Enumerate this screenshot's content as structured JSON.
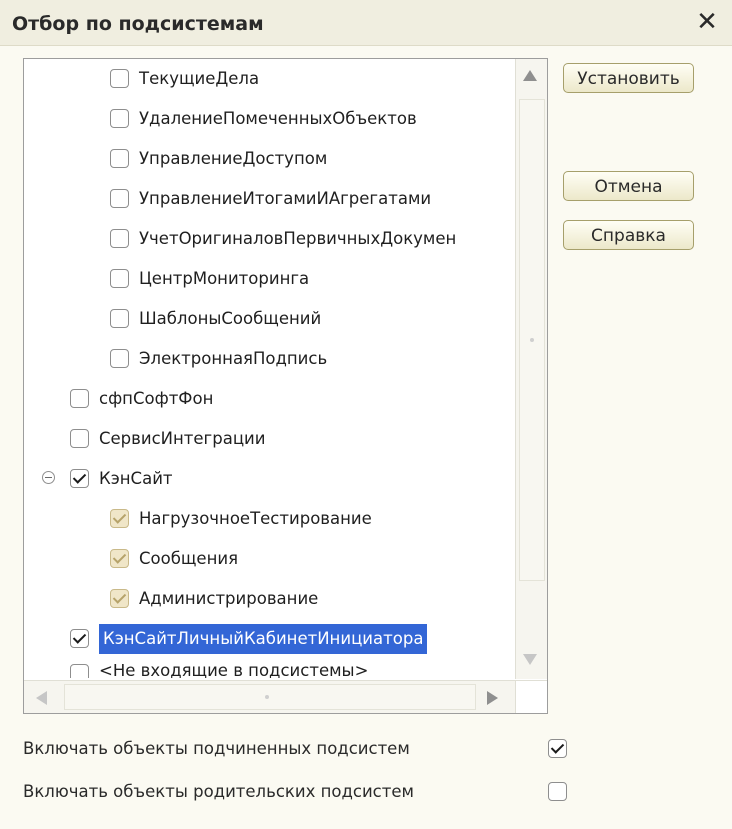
{
  "window": {
    "title": "Отбор по подсистемам",
    "close_glyph": "✕"
  },
  "tree": {
    "items": [
      {
        "label": "ТекущиеДела",
        "checked": false
      },
      {
        "label": "УдалениеПомеченныхОбъектов",
        "checked": false
      },
      {
        "label": "УправлениеДоступом",
        "checked": false
      },
      {
        "label": "УправлениеИтогамиИАгрегатами",
        "checked": false
      },
      {
        "label": "УчетОригиналовПервичныхДокумен",
        "checked": false
      },
      {
        "label": "ЦентрМониторинга",
        "checked": false
      },
      {
        "label": "ШаблоныСообщений",
        "checked": false
      },
      {
        "label": "ЭлектроннаяПодпись",
        "checked": false
      },
      {
        "label": "сфпСофтФон",
        "checked": false
      },
      {
        "label": "СервисИнтеграции",
        "checked": false
      },
      {
        "label": "КэнСайт",
        "checked": true,
        "expanded": true
      },
      {
        "label": "НагрузочноеТестирование",
        "checked": "inherited"
      },
      {
        "label": "Сообщения",
        "checked": "inherited"
      },
      {
        "label": "Администрирование",
        "checked": "inherited"
      },
      {
        "label": "КэнСайтЛичныйКабинетИнициатора",
        "checked": true,
        "selected": true
      },
      {
        "label": "<Не входящие в подсистемы>",
        "checked": false
      }
    ]
  },
  "buttons": {
    "set": "Установить",
    "cancel": "Отмена",
    "help": "Справка"
  },
  "options": {
    "include_child": {
      "label": "Включать объекты подчиненных подсистем",
      "checked": true
    },
    "include_parent": {
      "label": "Включать объекты родительских подсистем",
      "checked": false
    }
  },
  "icons": {
    "close": "close-icon",
    "collapse": "collapse-icon",
    "scroll_up": "arrow-up-icon",
    "scroll_down": "arrow-down-icon",
    "scroll_left": "arrow-left-icon",
    "scroll_right": "arrow-right-icon"
  }
}
